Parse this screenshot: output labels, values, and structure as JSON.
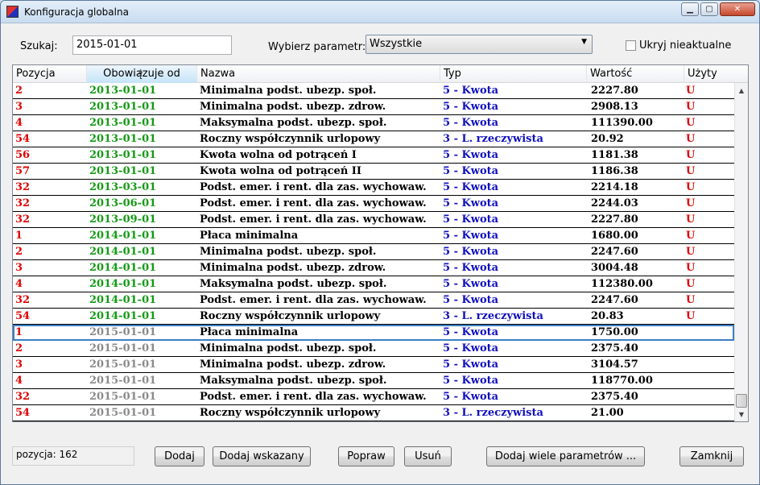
{
  "window": {
    "title": "Konfiguracja globalna",
    "minimize": "▁",
    "maximize": "▢",
    "close": "✕"
  },
  "search": {
    "label": "Szukaj:",
    "value": "2015-01-01"
  },
  "param": {
    "label": "Wybierz parametr:",
    "value": "Wszystkie"
  },
  "hide_outdated": {
    "label": "Ukryj nieaktualne",
    "checked": false
  },
  "table": {
    "headers": [
      "Pozycja",
      "Obowiązuje od",
      "Nazwa",
      "Typ",
      "Wartość",
      "Użyty"
    ],
    "rows": [
      [
        "2",
        "2013-01-01",
        "Minimalna podst. ubezp. społ.",
        "5 - Kwota",
        "2227.80",
        "U"
      ],
      [
        "3",
        "2013-01-01",
        "Minimalna podst. ubezp. zdrow.",
        "5 - Kwota",
        "2908.13",
        "U"
      ],
      [
        "4",
        "2013-01-01",
        "Maksymalna podst. ubezp. społ.",
        "5 - Kwota",
        "111390.00",
        "U"
      ],
      [
        "54",
        "2013-01-01",
        "Roczny współczynnik urlopowy",
        "3 - L. rzeczywista",
        "20.92",
        "U"
      ],
      [
        "56",
        "2013-01-01",
        "Kwota wolna od potrąceń I",
        "5 - Kwota",
        "1181.38",
        "U"
      ],
      [
        "57",
        "2013-01-01",
        "Kwota wolna od potrąceń II",
        "5 - Kwota",
        "1186.38",
        "U"
      ],
      [
        "32",
        "2013-03-01",
        "Podst. emer. i rent. dla zas. wychowaw.",
        "5 - Kwota",
        "2214.18",
        "U"
      ],
      [
        "32",
        "2013-06-01",
        "Podst. emer. i rent. dla zas. wychowaw.",
        "5 - Kwota",
        "2244.03",
        "U"
      ],
      [
        "32",
        "2013-09-01",
        "Podst. emer. i rent. dla zas. wychowaw.",
        "5 - Kwota",
        "2227.80",
        "U"
      ],
      [
        "1",
        "2014-01-01",
        "Płaca minimalna",
        "5 - Kwota",
        "1680.00",
        "U"
      ],
      [
        "2",
        "2014-01-01",
        "Minimalna podst. ubezp. społ.",
        "5 - Kwota",
        "2247.60",
        "U"
      ],
      [
        "3",
        "2014-01-01",
        "Minimalna podst. ubezp. zdrow.",
        "5 - Kwota",
        "3004.48",
        "U"
      ],
      [
        "4",
        "2014-01-01",
        "Maksymalna podst. ubezp. społ.",
        "5 - Kwota",
        "112380.00",
        "U"
      ],
      [
        "32",
        "2014-01-01",
        "Podst. emer. i rent. dla zas. wychowaw.",
        "5 - Kwota",
        "2247.60",
        "U"
      ],
      [
        "54",
        "2014-01-01",
        "Roczny współczynnik urlopowy",
        "3 - L. rzeczywista",
        "20.83",
        "U"
      ],
      [
        "1",
        "2015-01-01",
        "Płaca minimalna",
        "5 - Kwota",
        "1750.00",
        ""
      ],
      [
        "2",
        "2015-01-01",
        "Minimalna podst. ubezp. społ.",
        "5 - Kwota",
        "2375.40",
        ""
      ],
      [
        "3",
        "2015-01-01",
        "Minimalna podst. ubezp. zdrow.",
        "5 - Kwota",
        "3104.57",
        ""
      ],
      [
        "4",
        "2015-01-01",
        "Maksymalna podst. ubezp. społ.",
        "5 - Kwota",
        "118770.00",
        ""
      ],
      [
        "32",
        "2015-01-01",
        "Podst. emer. i rent. dla zas. wychowaw.",
        "5 - Kwota",
        "2375.40",
        ""
      ],
      [
        "54",
        "2015-01-01",
        "Roczny współczynnik urlopowy",
        "3 - L. rzeczywista",
        "21.00",
        ""
      ]
    ],
    "selected_row": 15
  },
  "status": {
    "text": "pozycja:  162"
  },
  "buttons": {
    "add": "Dodaj",
    "add_selected": "Dodaj wskazany",
    "edit": "Popraw",
    "delete": "Usuń",
    "add_many": "Dodaj wiele parametrów ...",
    "close": "Zamknij"
  },
  "colors": {
    "position": "#e00000",
    "date_past": "#139b13",
    "date_current": "#8a8a8a",
    "type": "#1010c0",
    "used": "#e00000"
  }
}
